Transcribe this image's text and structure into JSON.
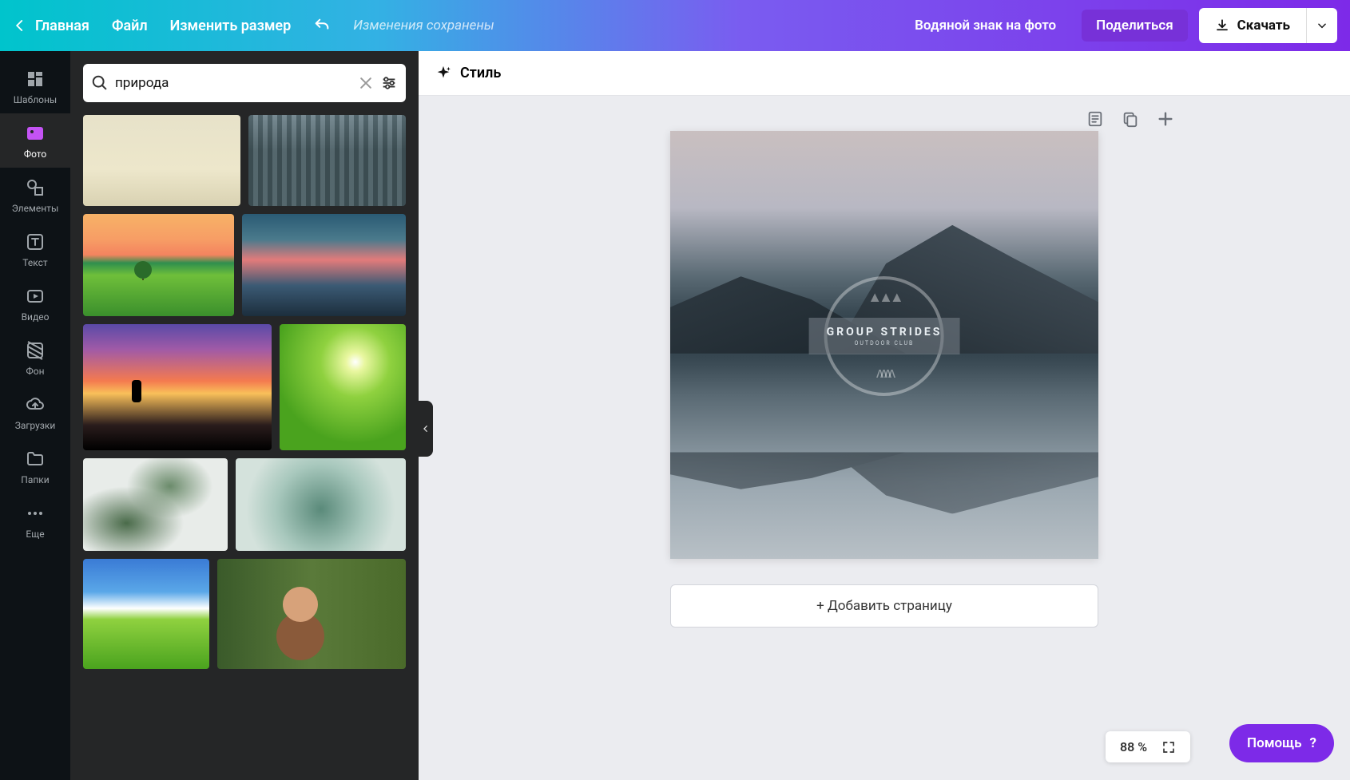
{
  "topbar": {
    "home": "Главная",
    "file": "Файл",
    "resize": "Изменить размер",
    "status": "Изменения сохранены",
    "watermark": "Водяной знак на фото",
    "share": "Поделиться",
    "download": "Скачать"
  },
  "rail": {
    "templates": "Шаблоны",
    "photos": "Фото",
    "elements": "Элементы",
    "text": "Текст",
    "video": "Видео",
    "background": "Фон",
    "uploads": "Загрузки",
    "folders": "Папки",
    "more": "Еще"
  },
  "search": {
    "value": "природа"
  },
  "context": {
    "style": "Стиль"
  },
  "canvas": {
    "badge_title": "GROUP STRIDES",
    "badge_sub": "OUTDOOR CLUB",
    "add_page": "+ Добавить страницу"
  },
  "footer": {
    "zoom": "88 %",
    "help": "Помощь"
  }
}
